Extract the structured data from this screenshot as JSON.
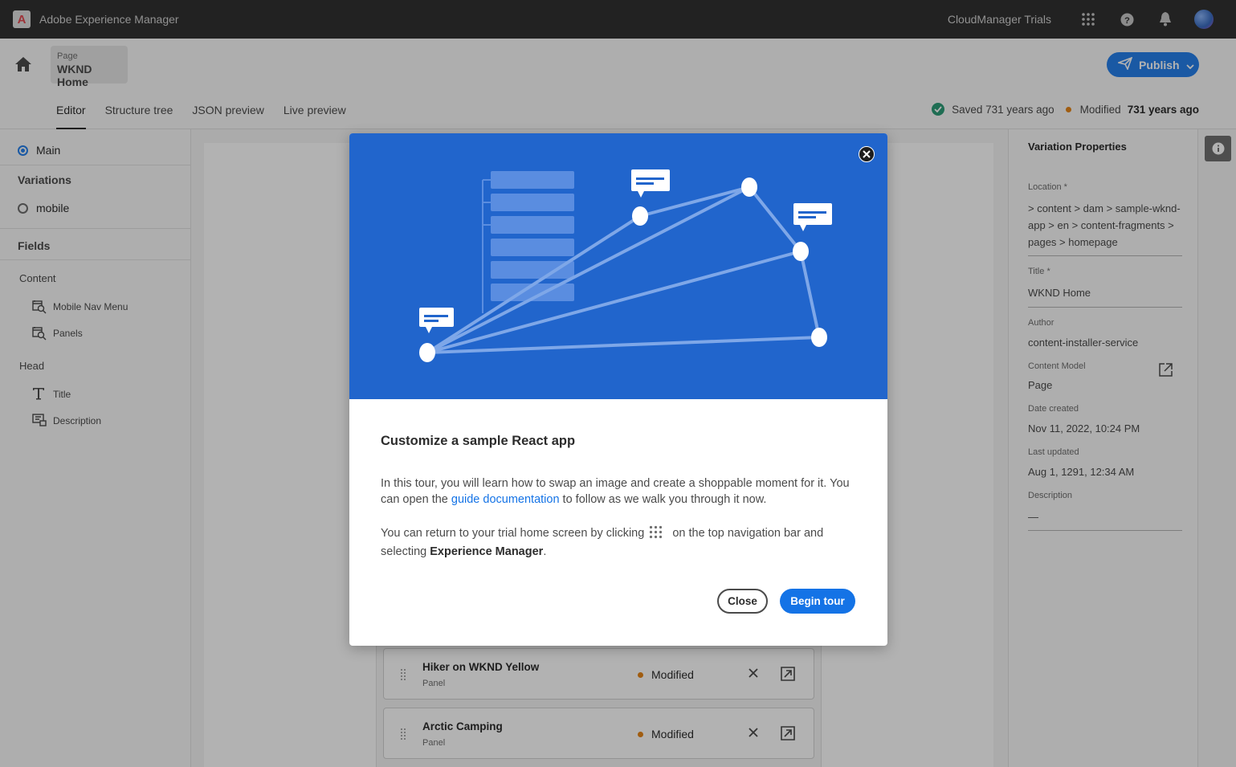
{
  "topbar": {
    "logo_letter": "A",
    "app_title": "Adobe Experience Manager",
    "org_name": "CloudManager Trials"
  },
  "header": {
    "page_label": "Page",
    "page_name": "WKND Home",
    "publish_label": "Publish",
    "tabs": [
      {
        "label": "Editor",
        "active": true
      },
      {
        "label": "Structure tree",
        "active": false
      },
      {
        "label": "JSON preview",
        "active": false
      },
      {
        "label": "Live preview",
        "active": false
      }
    ],
    "saved_text": "Saved 731 years ago",
    "modified_label": "Modified",
    "modified_time": "731 years ago"
  },
  "left_panel": {
    "main_label": "Main",
    "variations_heading": "Variations",
    "variation_item": "mobile",
    "fields_heading": "Fields",
    "groups": [
      {
        "label": "Content",
        "items": [
          "Mobile Nav Menu",
          "Panels"
        ]
      },
      {
        "label": "Head",
        "items": [
          "Title",
          "Description"
        ]
      }
    ]
  },
  "panels": [
    {
      "title": "Hiker on WKND Yellow",
      "type": "Panel",
      "status": "Modified"
    },
    {
      "title": "Arctic Camping",
      "type": "Panel",
      "status": "Modified"
    }
  ],
  "right_panel": {
    "title": "Variation Properties",
    "location_label": "Location",
    "location_value": " > content > dam > sample-wknd-app > en > content-fragments > pages > homepage",
    "title_label": "Title",
    "title_value": "WKND Home",
    "author_label": "Author",
    "author_value": "content-installer-service",
    "model_label": "Content Model",
    "model_value": "Page",
    "created_label": "Date created",
    "created_value": "Nov 11, 2022, 10:24 PM",
    "updated_label": "Last updated",
    "updated_value": "Aug 1, 1291, 12:34 AM",
    "description_label": "Description",
    "description_value": "—",
    "required_mark": "*"
  },
  "modal": {
    "heading": "Customize a sample React app",
    "p1_a": "In this tour, you will learn how to swap an image and create a shoppable moment for it. You can open the ",
    "p1_link": "guide documentation",
    "p1_b": " to follow as we walk you through it now.",
    "p2_a": "You can return to your trial home screen by clicking",
    "p2_b": " on the top navigation bar and selecting ",
    "p2_bold": "Experience Manager",
    "p2_end": ".",
    "close_label": "Close",
    "begin_label": "Begin tour"
  },
  "colors": {
    "accent": "#1473e6",
    "hero_blue": "#2165cc",
    "topbar": "#323232",
    "status_ok": "#2d9d78",
    "status_modified": "#e68619"
  },
  "icons": [
    "adobe-logo-icon",
    "apps-grid-icon",
    "help-icon",
    "bell-icon",
    "avatar",
    "home-icon",
    "publish-icon",
    "chevron-down-icon",
    "check-circle-icon",
    "radio-icon",
    "fragment-reference-icon",
    "text-icon",
    "multiline-icon",
    "info-icon",
    "close-icon",
    "drag-handle-icon",
    "remove-icon",
    "open-in-editor-icon",
    "external-link-icon"
  ]
}
